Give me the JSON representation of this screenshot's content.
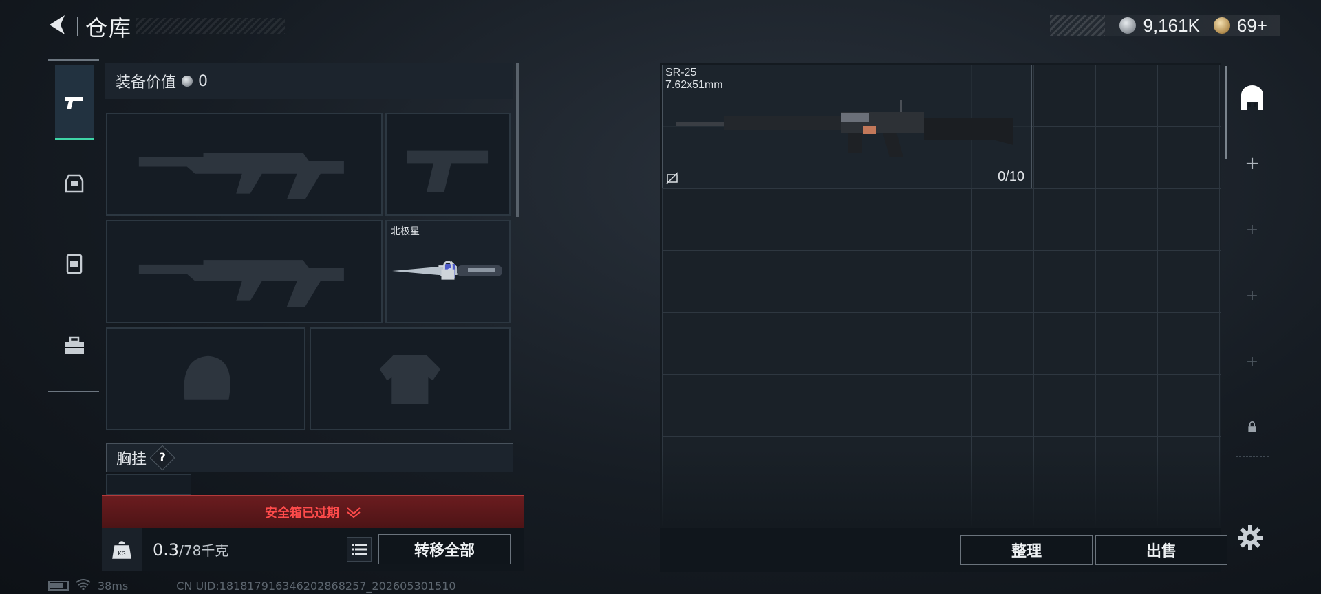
{
  "header": {
    "title": "仓库",
    "currencies": [
      {
        "icon": "silver-coin-icon",
        "value": "9,161K"
      },
      {
        "icon": "gold-coin-icon",
        "value": "69+"
      }
    ]
  },
  "rail": {
    "tabs": [
      {
        "icon": "pistol-icon",
        "active": true
      },
      {
        "icon": "armor-icon",
        "active": false
      },
      {
        "icon": "backpack-icon",
        "active": false
      },
      {
        "icon": "toolbox-icon",
        "active": false
      }
    ]
  },
  "loadout": {
    "equip_value_label": "装备价值",
    "equip_value": "0",
    "melee_slot_name": "北极星",
    "chest_rig_label": "胸挂",
    "chest_rig_help": "?"
  },
  "safebox": {
    "alert_text": "安全箱已过期",
    "alert_color": "#ff4b4b"
  },
  "weight": {
    "current": "0.3",
    "max": "/78千克"
  },
  "buttons": {
    "transfer_all": "转移全部",
    "sort": "整理",
    "sell": "出售"
  },
  "storage": {
    "item": {
      "name": "SR-25",
      "ammo": "7.62x51mm",
      "count": "0/10"
    }
  },
  "status": {
    "ping": "38ms",
    "uid": "CN UID:1818179163462028682​57_202605301510"
  },
  "colors": {
    "accent": "#3fd5a7",
    "alert_bg": "#5a181a"
  }
}
